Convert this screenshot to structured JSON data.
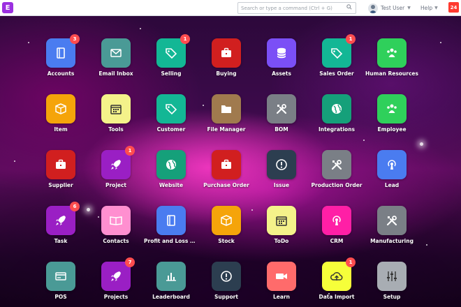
{
  "navbar": {
    "logo_letter": "E",
    "search_placeholder": "Search or type a command (Ctrl + G)",
    "user_name": "Test User",
    "help_label": "Help",
    "notification_count": "24"
  },
  "colors": {
    "brand": "#9b30e0",
    "badge": "#ff4d4f",
    "notification": "#ff3b30"
  },
  "modules": [
    {
      "label": "Accounts",
      "icon": "book-icon",
      "color": "#4a7cf0",
      "badge": "3"
    },
    {
      "label": "Email Inbox",
      "icon": "mail-icon",
      "color": "#4a9a96",
      "badge": ""
    },
    {
      "label": "Selling",
      "icon": "tag-icon",
      "color": "#13b795",
      "badge": "1"
    },
    {
      "label": "Buying",
      "icon": "briefcase-icon",
      "color": "#d11f1f",
      "badge": ""
    },
    {
      "label": "Assets",
      "icon": "database-icon",
      "color": "#7b4ff6",
      "badge": ""
    },
    {
      "label": "Sales Order",
      "icon": "tag-icon",
      "color": "#13b795",
      "badge": "1"
    },
    {
      "label": "Human Resources",
      "icon": "people-icon",
      "color": "#2fd05b",
      "badge": ""
    },
    {
      "label": "Item",
      "icon": "box-icon",
      "color": "#f5a40a",
      "badge": ""
    },
    {
      "label": "Tools",
      "icon": "calendar-icon",
      "color": "#f4f28a",
      "badge": ""
    },
    {
      "label": "Customer",
      "icon": "tag-icon",
      "color": "#13b795",
      "badge": ""
    },
    {
      "label": "File Manager",
      "icon": "folder-icon",
      "color": "#a07a4e",
      "badge": ""
    },
    {
      "label": "BOM",
      "icon": "tools-icon",
      "color": "#7a7f86",
      "badge": ""
    },
    {
      "label": "Integrations",
      "icon": "globe-icon",
      "color": "#15a07a",
      "badge": ""
    },
    {
      "label": "Employee",
      "icon": "people-icon",
      "color": "#2fd05b",
      "badge": ""
    },
    {
      "label": "Supplier",
      "icon": "briefcase-icon",
      "color": "#d11f1f",
      "badge": ""
    },
    {
      "label": "Project",
      "icon": "rocket-icon",
      "color": "#9a1fc4",
      "badge": "1"
    },
    {
      "label": "Website",
      "icon": "globe-icon",
      "color": "#15a07a",
      "badge": ""
    },
    {
      "label": "Purchase Order",
      "icon": "briefcase-icon",
      "color": "#d11f1f",
      "badge": ""
    },
    {
      "label": "Issue",
      "icon": "alert-icon",
      "color": "#2c3e50",
      "badge": ""
    },
    {
      "label": "Production Order",
      "icon": "tools-icon",
      "color": "#7a7f86",
      "badge": ""
    },
    {
      "label": "Lead",
      "icon": "broadcast-icon",
      "color": "#4a7cf0",
      "badge": ""
    },
    {
      "label": "Task",
      "icon": "rocket-icon",
      "color": "#9a1fc4",
      "badge": "6"
    },
    {
      "label": "Contacts",
      "icon": "open-book-icon",
      "color": "#ff8fd0",
      "badge": ""
    },
    {
      "label": "Profit and Loss Statement",
      "icon": "book-icon",
      "color": "#4a7cf0",
      "badge": ""
    },
    {
      "label": "Stock",
      "icon": "box-icon",
      "color": "#f5a40a",
      "badge": ""
    },
    {
      "label": "ToDo",
      "icon": "calendar-icon",
      "color": "#f4f28a",
      "badge": ""
    },
    {
      "label": "CRM",
      "icon": "broadcast-icon",
      "color": "#ff1fa6",
      "badge": ""
    },
    {
      "label": "Manufacturing",
      "icon": "tools-icon",
      "color": "#7a7f86",
      "badge": ""
    },
    {
      "label": "POS",
      "icon": "card-icon",
      "color": "#4a9a96",
      "badge": ""
    },
    {
      "label": "Projects",
      "icon": "rocket-icon",
      "color": "#9a1fc4",
      "badge": "7"
    },
    {
      "label": "Leaderboard",
      "icon": "bar-chart-icon",
      "color": "#4a9a96",
      "badge": ""
    },
    {
      "label": "Support",
      "icon": "alert-icon",
      "color": "#2c3e50",
      "badge": ""
    },
    {
      "label": "Learn",
      "icon": "video-icon",
      "color": "#ff6b6b",
      "badge": ""
    },
    {
      "label": "Data Import",
      "icon": "cloud-upload-icon",
      "color": "#f6ff3a",
      "badge": "1"
    },
    {
      "label": "Setup",
      "icon": "sliders-icon",
      "color": "#a8adb3",
      "badge": ""
    }
  ]
}
